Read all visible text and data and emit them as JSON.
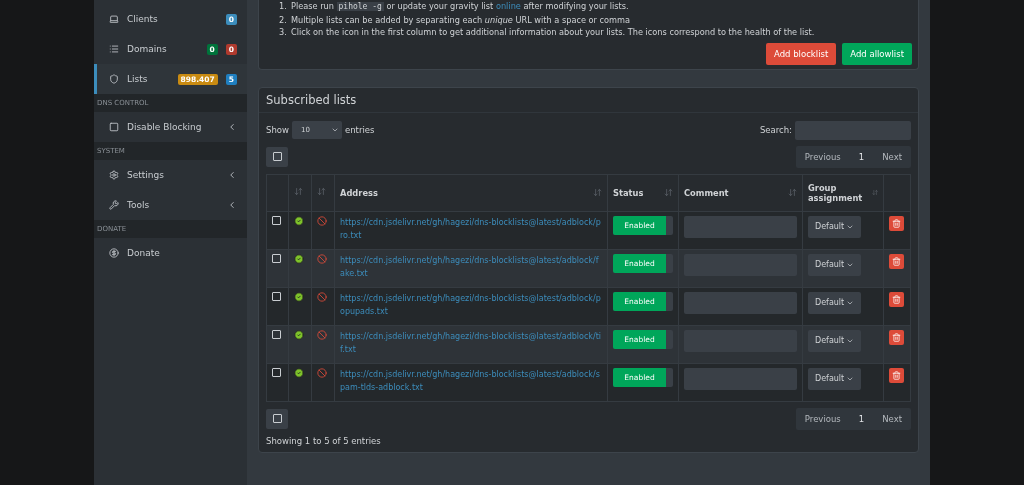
{
  "sidebar": {
    "items": [
      {
        "kind": "item",
        "label": "Clients",
        "selected": false,
        "badges": [
          {
            "text": "0",
            "color": "#3c8dbc"
          }
        ]
      },
      {
        "kind": "item",
        "label": "Domains",
        "selected": false,
        "badges": [
          {
            "text": "0",
            "color": "#00733b"
          },
          {
            "text": "0",
            "color": "#b03a2e"
          }
        ]
      },
      {
        "kind": "item",
        "label": "Lists",
        "selected": true,
        "badges": [
          {
            "text": "898.407",
            "color": "#c98b12"
          },
          {
            "text": "5",
            "color": "#1f7fc0"
          }
        ]
      },
      {
        "kind": "header",
        "label": "DNS CONTROL"
      },
      {
        "kind": "item",
        "label": "Disable Blocking",
        "selected": false,
        "submenu": true
      },
      {
        "kind": "header",
        "label": "SYSTEM"
      },
      {
        "kind": "item",
        "label": "Settings",
        "selected": false,
        "submenu": true
      },
      {
        "kind": "item",
        "label": "Tools",
        "selected": false,
        "submenu": true
      },
      {
        "kind": "header",
        "label": "DONATE"
      },
      {
        "kind": "item",
        "label": "Donate",
        "selected": false
      }
    ]
  },
  "notes": [
    [
      {
        "kind": "marker",
        "text": "1."
      },
      {
        "kind": "text",
        "text": "Please run "
      },
      {
        "kind": "code",
        "text": "pihole -g"
      },
      {
        "kind": "text",
        "text": " or update your gravity list "
      },
      {
        "kind": "link",
        "text": "online"
      },
      {
        "kind": "text",
        "text": " after modifying your lists."
      }
    ],
    [
      {
        "kind": "marker",
        "text": "2."
      },
      {
        "kind": "text",
        "text": "Multiple lists can be added by separating each *unique* URL with a space or comma"
      }
    ],
    [
      {
        "kind": "marker",
        "text": "3."
      },
      {
        "kind": "text",
        "text": "Click on the icon in the first column to get additional information about your lists. The icons correspond to the health of the list."
      }
    ]
  ],
  "actions": [
    {
      "label": "Add blocklist",
      "kind": "danger"
    },
    {
      "label": "Add allowlist",
      "kind": "success"
    }
  ],
  "card": {
    "title": "Subscribed lists",
    "show_label": "Show",
    "page_size": "10",
    "entries_label": "entries",
    "search_label": "Search:",
    "columns": [
      "Address",
      "Status",
      "Comment",
      "Group assignment"
    ],
    "rows": [
      {
        "address": "https://cdn.jsdelivr.net/gh/hagezi/dns-blocklists@latest/adblock/pro.txt",
        "checked": false,
        "status": "Enabled",
        "enabled": true,
        "group": "Default"
      },
      {
        "address": "https://cdn.jsdelivr.net/gh/hagezi/dns-blocklists@latest/adblock/fake.txt",
        "checked": false,
        "status": "Enabled",
        "enabled": true,
        "group": "Default"
      },
      {
        "address": "https://cdn.jsdelivr.net/gh/hagezi/dns-blocklists@latest/adblock/popupads.txt",
        "checked": false,
        "status": "Enabled",
        "enabled": true,
        "group": "Default"
      },
      {
        "address": "https://cdn.jsdelivr.net/gh/hagezi/dns-blocklists@latest/adblock/tif.txt",
        "checked": false,
        "status": "Enabled",
        "enabled": true,
        "group": "Default"
      },
      {
        "address": "https://cdn.jsdelivr.net/gh/hagezi/dns-blocklists@latest/adblock/spam-tlds-adblock.txt",
        "checked": false,
        "status": "Enabled",
        "enabled": true,
        "group": "Default"
      }
    ],
    "top_pagination": {
      "previous": "Previous",
      "page": "1",
      "next": "Next"
    },
    "bottom_pagination": {
      "previous": "Previous",
      "page": "1",
      "next": "Next"
    },
    "footer": "Showing 1 to 5 of 5 entries"
  }
}
